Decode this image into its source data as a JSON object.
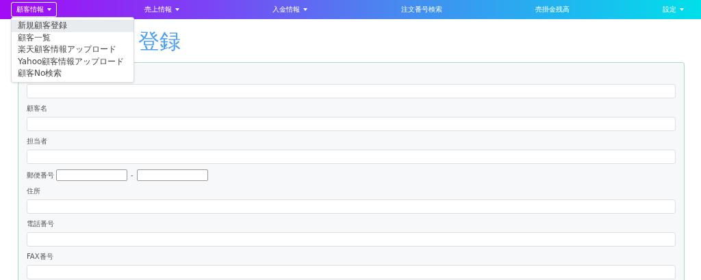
{
  "navbar": {
    "items": [
      {
        "label": "顧客情報",
        "caret": true,
        "selected": true
      },
      {
        "label": "売上情報",
        "caret": true,
        "selected": false
      },
      {
        "label": "入金情報",
        "caret": true,
        "selected": false
      },
      {
        "label": "注文番号検索",
        "caret": false,
        "selected": false
      },
      {
        "label": "売掛金残高",
        "caret": false,
        "selected": false
      },
      {
        "label": "設定",
        "caret": true,
        "selected": false
      }
    ]
  },
  "dropdown": {
    "items": [
      {
        "label": "新規顧客登録",
        "selected": true
      },
      {
        "label": "顧客一覧",
        "selected": false
      },
      {
        "label": "楽天顧客情報アップロード",
        "selected": false
      },
      {
        "label": "Yahoo顧客情報アップロード",
        "selected": false
      },
      {
        "label": "顧客No検索",
        "selected": false
      }
    ]
  },
  "heading": "登録",
  "form": {
    "fields": [
      {
        "kind": "text"
      },
      {
        "kind": "text",
        "label": "顧客名"
      },
      {
        "kind": "text",
        "label": "担当者"
      },
      {
        "kind": "postal",
        "label": "郵便番号",
        "separator": "-"
      },
      {
        "kind": "text",
        "label": "住所"
      },
      {
        "kind": "text",
        "label": "電話番号"
      },
      {
        "kind": "text",
        "label": "FAX番号"
      }
    ]
  }
}
